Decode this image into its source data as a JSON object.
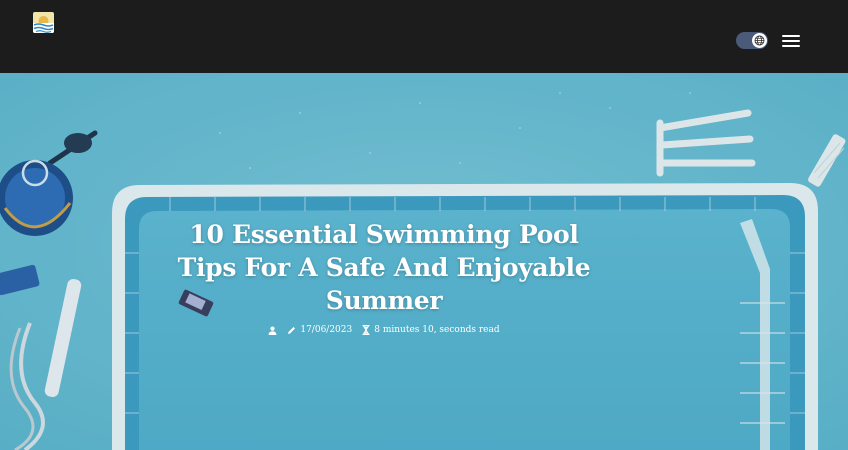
{
  "header": {
    "logo_icon": "site-logo-waves-icon",
    "theme_toggle_icon": "globe-icon",
    "menu_icon": "hamburger-menu-icon"
  },
  "article": {
    "title": "10 Essential Swimming Pool Tips For A Safe And Enjoyable Summer",
    "author_icon": "user-icon",
    "date_icon": "pencil-icon",
    "date": "17/06/2023",
    "read_time_icon": "hourglass-icon",
    "read_time": "8 minutes 10, seconds read"
  },
  "colors": {
    "header_bg": "#1c1c1c",
    "pool_water": "#6cc0d4",
    "pool_deep": "#4fb0cc",
    "pool_edge": "#e8f3f5",
    "toggle_bg": "#4a5a78",
    "text": "#ffffff"
  }
}
